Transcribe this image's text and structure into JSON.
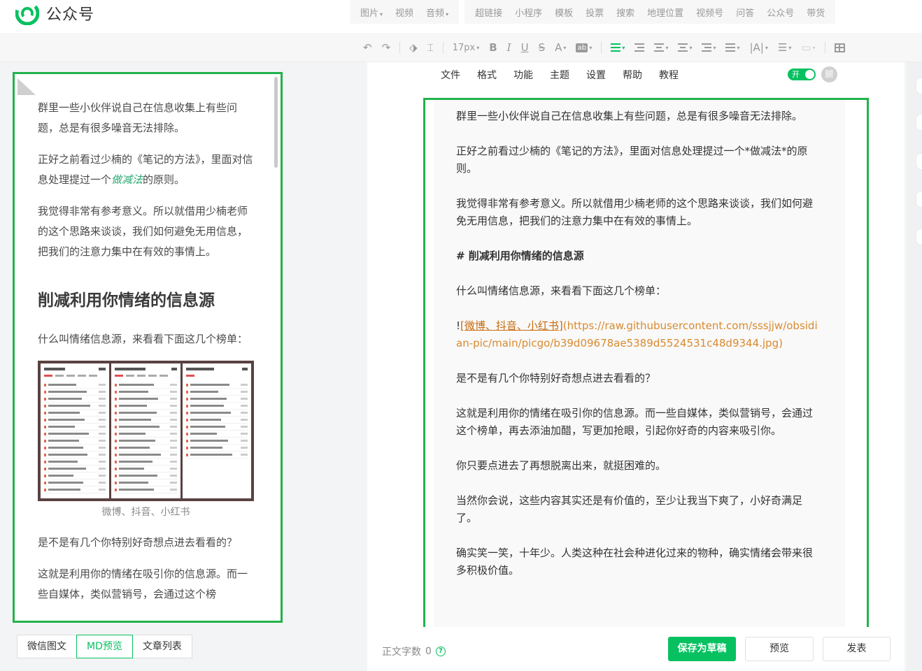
{
  "app": {
    "title": "公众号"
  },
  "insert_toolbar": {
    "group1": [
      "图片",
      "视频",
      "音频"
    ],
    "group1_dropdown": [
      true,
      false,
      true
    ],
    "group2": [
      "超链接",
      "小程序",
      "模板",
      "投票",
      "搜索",
      "地理位置",
      "视频号",
      "问答",
      "公众号",
      "带货"
    ]
  },
  "format_toolbar": {
    "font_size": "17px"
  },
  "menu": {
    "items": [
      "文件",
      "格式",
      "功能",
      "主题",
      "设置",
      "帮助",
      "教程"
    ]
  },
  "toggle": {
    "label": "开",
    "on": true
  },
  "avatar": {
    "text": "腿"
  },
  "preview": {
    "p1": "群里一些小伙伴说自己在信息收集上有些问题，总是有很多噪音无法排除。",
    "p2_before": "正好之前看过少楠的《笔记的方法》，里面对信息处理提过一个",
    "p2_em": "做减法",
    "p2_after": "的原则。",
    "p3": "我觉得非常有参考意义。所以就借用少楠老师的这个思路来谈谈，我们如何避免无用信息，把我们的注意力集中在有效的事情上。",
    "h2": "削减利用你情绪的信息源",
    "p4": "什么叫情绪信息源，来看看下面这几个榜单：",
    "image_caption": "微博、抖音、小红书",
    "p5": "是不是有几个你特别好奇想点进去看看的？",
    "p6": "这就是利用你的情绪在吸引你的信息源。而一些自媒体，类似营销号，会通过这个榜"
  },
  "left_tabs": [
    "微信图文",
    "MD预览",
    "文章列表"
  ],
  "left_tabs_active": "MD预览",
  "markdown": {
    "p1": "群里一些小伙伴说自己在信息收集上有些问题，总是有很多噪音无法排除。",
    "p2": "正好之前看过少楠的《笔记的方法》，里面对信息处理提过一个*做减法*的原则。",
    "p3": "我觉得非常有参考意义。所以就借用少楠老师的这个思路来谈谈，我们如何避免无用信息，把我们的注意力集中在有效的事情上。",
    "h": "# 削减利用你情绪的信息源",
    "p4": "什么叫情绪信息源，来看看下面这几个榜单：",
    "img_bang": "!",
    "img_label": "[微博、抖音、小红书]",
    "img_url": "(https://raw.githubusercontent.com/sssjjw/obsidian-pic/main/picgo/b39d09678ae5389d5524531c48d9344.jpg)",
    "p5": "是不是有几个你特别好奇想点进去看看的？",
    "p6": "这就是利用你的情绪在吸引你的信息源。而一些自媒体，类似营销号，会通过这个榜单，再去添油加醋，写更加抢眼，引起你好奇的内容来吸引你。",
    "p7": "你只要点进去了再想脱离出来，就挺困难的。",
    "p8": "当然你会说，这些内容其实还是有价值的，至少让我当下爽了，小好奇满足了。",
    "p9": "确实笑一笑，十年少。人类这种在社会种进化过来的物种，确实情绪会带来很多积极价值。"
  },
  "footer": {
    "word_count_label": "正文字数",
    "word_count": "0",
    "save_draft": "保存为草稿",
    "preview": "预览",
    "publish": "发表"
  },
  "colors": {
    "accent": "#07c160",
    "highlight_frame": "#22b24c",
    "link": "#c76a0c"
  }
}
